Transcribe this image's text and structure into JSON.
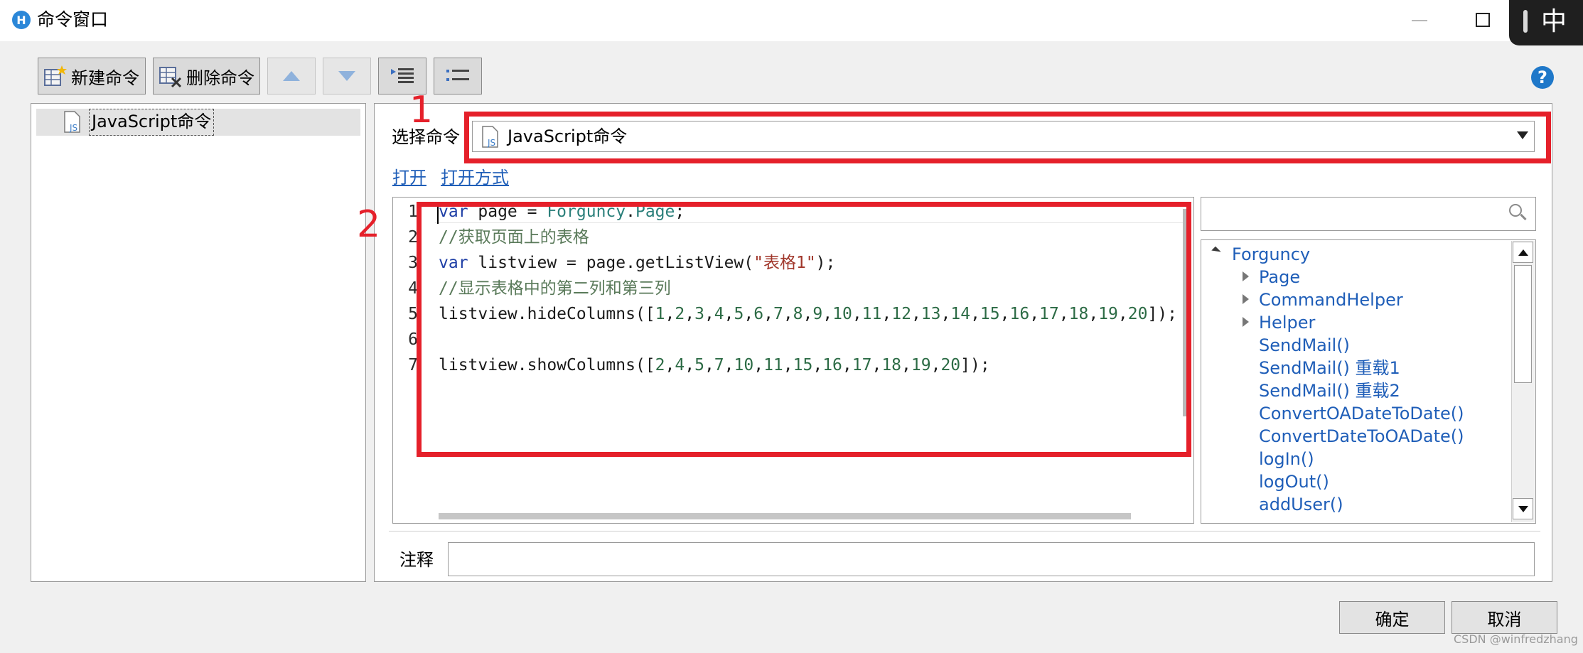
{
  "window": {
    "title": "命令窗口",
    "app_icon": "hz-logo-icon",
    "ime_indicator": "中"
  },
  "toolbar": {
    "new_command": "新建命令",
    "delete_command": "删除命令",
    "move_up": "arrow-up-icon",
    "move_down": "arrow-down-icon",
    "indent": "indent-icon",
    "outdent": "outdent-icon"
  },
  "command_tree": {
    "items": [
      {
        "label": "JavaScript命令",
        "icon": "js-file-icon"
      }
    ]
  },
  "editor": {
    "select_label": "选择命令",
    "selected_command": "JavaScript命令",
    "links": {
      "open": "打开",
      "open_with": "打开方式"
    },
    "line_numbers": [
      "1",
      "2",
      "3",
      "4",
      "5",
      "6",
      "7"
    ],
    "code_lines": [
      "var page = Forguncy.Page;",
      "//获取页面上的表格",
      "var listview = page.getListView(\"表格1\");",
      "//显示表格中的第二列和第三列",
      "listview.hideColumns([1,2,3,4,5,6,7,8,9,10,11,12,13,14,15,16,17,18,19,20]);",
      "",
      "listview.showColumns([2,4,5,7,10,11,15,16,17,18,19,20]);"
    ]
  },
  "annotations": {
    "box1": "1",
    "box2": "2",
    "color": "#e5202a"
  },
  "api_tree": {
    "search_placeholder": "",
    "root": "Forguncy",
    "expandable": [
      "Page",
      "CommandHelper",
      "Helper"
    ],
    "methods": [
      "SendMail()",
      "SendMail() 重载1",
      "SendMail() 重载2",
      "ConvertOADateToDate()",
      "ConvertDateToOADate()",
      "logIn()",
      "logOut()",
      "addUser()"
    ]
  },
  "note": {
    "label": "注释",
    "value": ""
  },
  "footer": {
    "ok": "确定",
    "cancel": "取消",
    "watermark": "CSDN @winfredzhang"
  }
}
